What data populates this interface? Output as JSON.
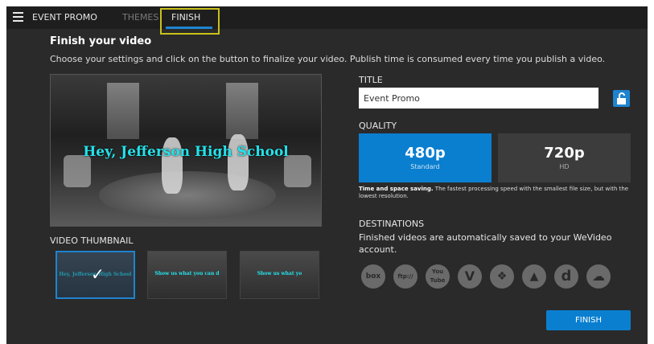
{
  "tabs": [
    {
      "label": "EVENT PROMO"
    },
    {
      "label": "THEMES"
    },
    {
      "label": "FINISH"
    }
  ],
  "heading": "Finish your video",
  "description": "Choose your settings and click on the button to finalize your video. Publish time is consumed every time you publish a video.",
  "preview": {
    "overlay_text": "Hey, Jefferson High School"
  },
  "thumbnail_section": {
    "label": "VIDEO THUMBNAIL",
    "items": [
      {
        "text": "Hey, Jefferson High School",
        "selected": true
      },
      {
        "text": "Show us what you can d",
        "selected": false
      },
      {
        "text": "Show us what yo",
        "selected": false
      }
    ]
  },
  "title_section": {
    "label": "TITLE",
    "value": "Event Promo"
  },
  "quality": {
    "label": "QUALITY",
    "options": [
      {
        "resolution": "480p",
        "name": "Standard",
        "selected": true
      },
      {
        "resolution": "720p",
        "name": "HD",
        "selected": false
      }
    ],
    "note_bold": "Time and space saving.",
    "note_rest": " The fastest processing speed with the smallest file size, but with the lowest resolution."
  },
  "destinations": {
    "label": "DESTINATIONS",
    "text": "Finished videos are automatically saved to your WeVideo account.",
    "items": [
      {
        "glyph": "box",
        "icon": "box-icon"
      },
      {
        "glyph": "ftp://",
        "icon": "ftp-icon"
      },
      {
        "glyph": "You Tube",
        "icon": "youtube-icon"
      },
      {
        "glyph": "V",
        "icon": "vimeo-icon"
      },
      {
        "glyph": "❖",
        "icon": "dropbox-icon"
      },
      {
        "glyph": "▲",
        "icon": "google-drive-icon"
      },
      {
        "glyph": "d",
        "icon": "dailymotion-icon"
      },
      {
        "glyph": "☁",
        "icon": "cloud-icon"
      }
    ]
  },
  "finish_button": "FINISH",
  "colors": {
    "accent": "#0a7fd0",
    "highlight": "#c9c21b",
    "preview_text": "#24e2ea"
  }
}
